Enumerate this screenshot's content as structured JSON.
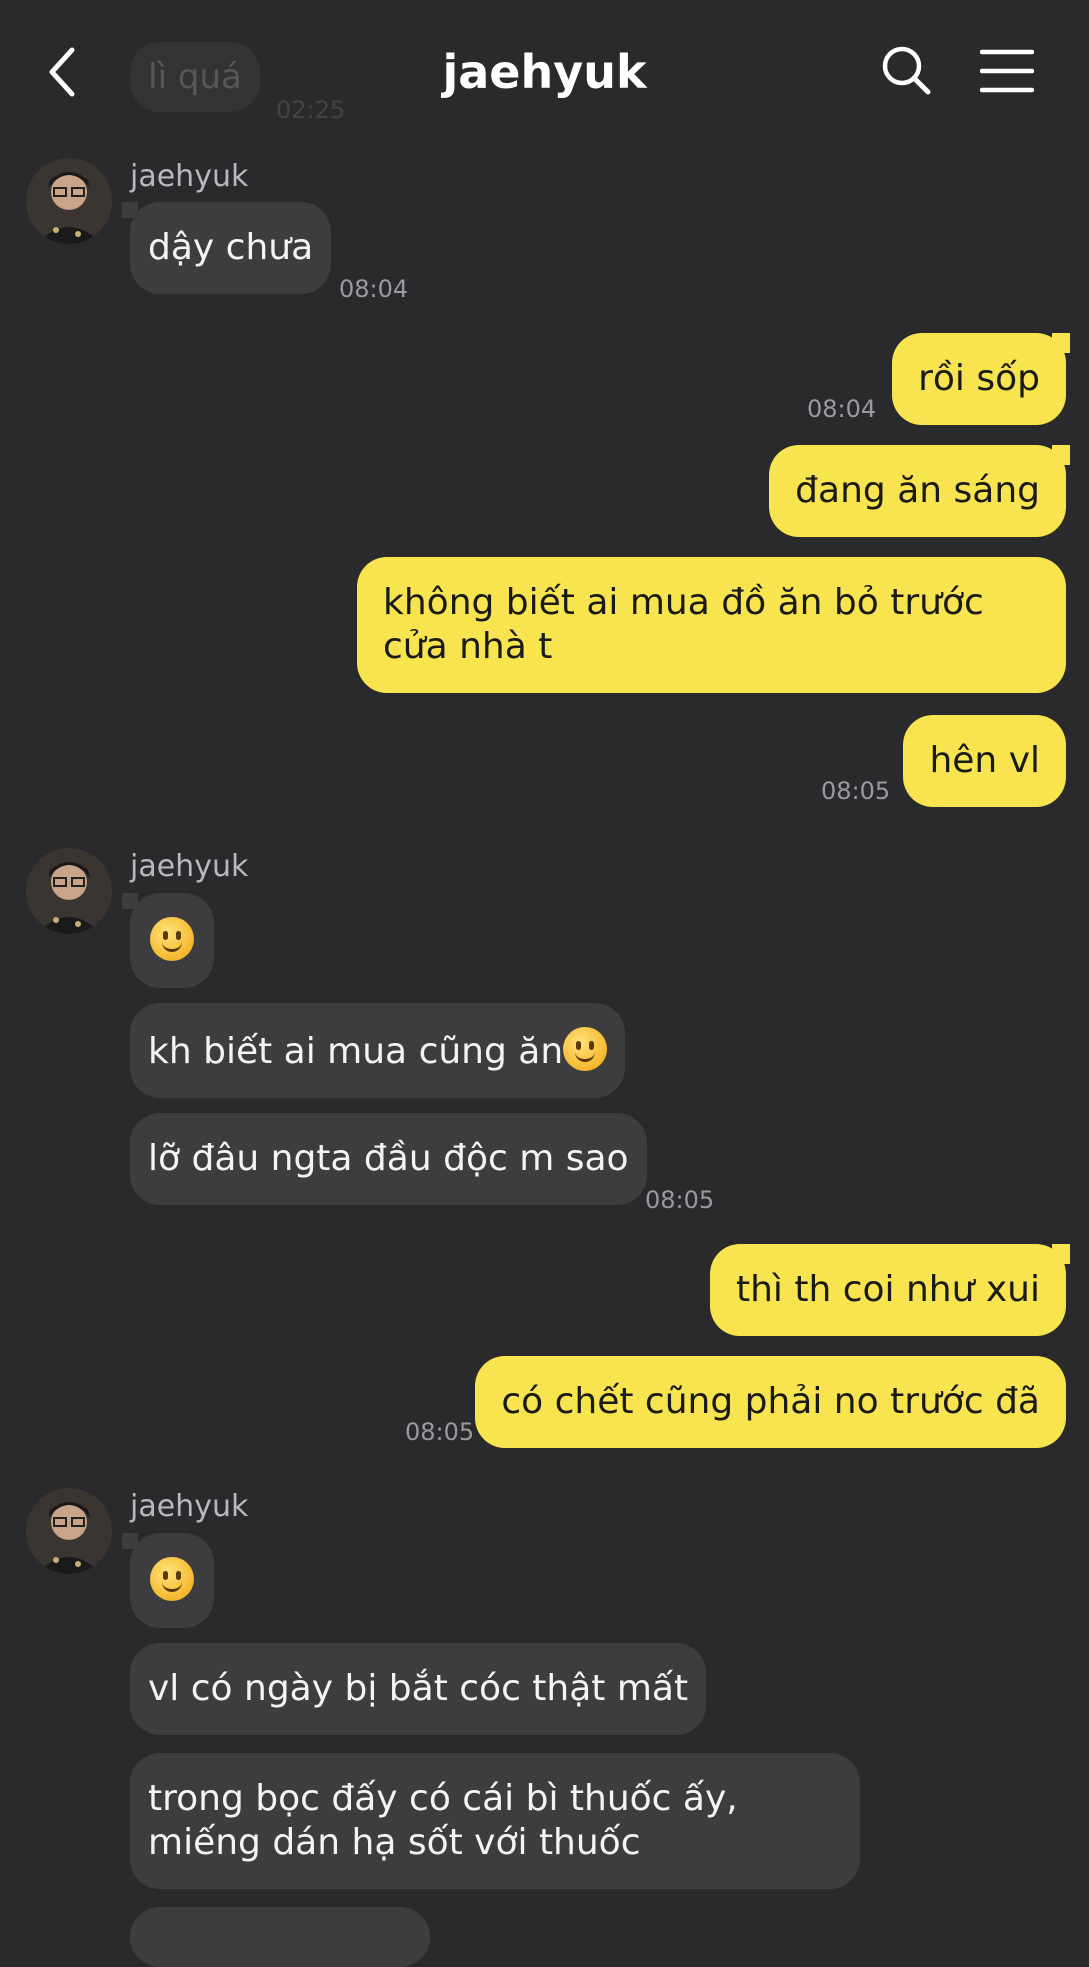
{
  "header": {
    "title": "jaehyuk",
    "ghost_text": "lì quá",
    "ghost_time": "02:25",
    "back_icon": "chevron-left-icon",
    "search_icon": "search-icon",
    "menu_icon": "hamburger-menu-icon"
  },
  "colors": {
    "background": "#2a2a2c",
    "incoming_bubble": "#3d3d40",
    "outgoing_bubble": "#f7e44f",
    "timestamp": "#9a9a9e"
  },
  "messages": {
    "g1": {
      "sender": "jaehyuk",
      "m1": "dậy chưa",
      "time": "08:04"
    },
    "o1": {
      "m1": "rồi sốp",
      "time1": "08:04",
      "m2": "đang ăn sáng",
      "m3": "không biết ai mua đồ ăn bỏ trước cửa nhà t",
      "m4": "hên vl",
      "time4": "08:05"
    },
    "g2": {
      "sender": "jaehyuk",
      "m1_emoji": "slightly-smiling-face",
      "m2": "kh biết ai mua cũng ăn",
      "m3": "lỡ đâu ngta đầu độc m sao",
      "time": "08:05"
    },
    "o2": {
      "m1": "thì th coi như xui",
      "m2": "có chết cũng phải no trước đã",
      "time": "08:05"
    },
    "g3": {
      "sender": "jaehyuk",
      "m1_emoji": "slightly-smiling-face",
      "m2": "vl có ngày bị bắt cóc thật mất",
      "m3": "trong bọc đấy có cái bì thuốc ấy, miếng dán hạ sốt với thuốc"
    }
  }
}
